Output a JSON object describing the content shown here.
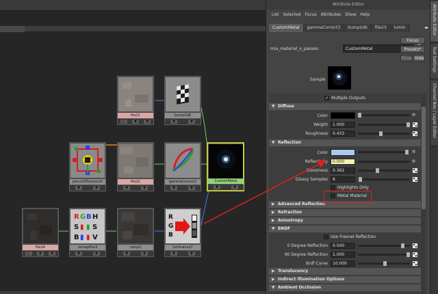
{
  "attribute_editor": {
    "title": "Attribute Editor",
    "menu": [
      "List",
      "Selected",
      "Focus",
      "Attributes",
      "Show",
      "Help"
    ],
    "tabs": [
      "CustomMetal",
      "gammaCorrect3",
      "bump2d6",
      "file23",
      "lumin"
    ],
    "active_tab": "CustomMetal",
    "node_type_label": "mia_material_x_passes:",
    "node_name": "CustomMetal",
    "buttons": {
      "focus": "Focus",
      "presets": "Presets*",
      "show": "Show",
      "hide": "Hide"
    },
    "sample_label": "Sample",
    "multiple_outputs": {
      "label": "Multiple Outputs",
      "checked": "✓"
    },
    "sections": {
      "diffuse": {
        "title": "Diffuse",
        "color_label": "Color",
        "color_value": "#000000",
        "weight_label": "Weight",
        "weight_value": "1.000",
        "weight_level": 1.0,
        "roughness_label": "Roughness",
        "roughness_value": "0.433",
        "roughness_level": 0.433
      },
      "reflection": {
        "title": "Reflection",
        "color_label": "Color",
        "color_value": "#a9c8f0",
        "reflectivity_label": "Reflectivity",
        "reflectivity_value": "0.000",
        "glossiness_label": "Glossiness",
        "glossiness_value": "0.362",
        "glossiness_level": 0.362,
        "glossy_samples_label": "Glossy Samples",
        "glossy_samples_value": "6",
        "highlights_only_label": "Highlights Only",
        "metal_material_label": "Metal Material"
      },
      "advanced_reflection": {
        "title": "Advanced Reflection"
      },
      "refraction": {
        "title": "Refraction"
      },
      "anisotropy": {
        "title": "Anisotropy"
      },
      "brdf": {
        "title": "BRDF",
        "use_fresnel_label": "Use Fresnel Reflection",
        "deg0_label": "0 Degree Reflection",
        "deg0_value": "0.500",
        "deg0_level": 0.5,
        "deg90_label": "90 Degree Reflection",
        "deg90_value": "1.000",
        "deg90_level": 1.0,
        "curve_label": "Brdf Curve",
        "curve_value": "10.000",
        "curve_level": 0.5
      },
      "translucency": {
        "title": "Translucency"
      },
      "indirect": {
        "title": "Indirect Illumination Options"
      },
      "ambient": {
        "title": "Ambient Occlusion"
      }
    }
  },
  "side_tabs": [
    "Attribute Editor",
    "Tool Settings",
    "Channel Box / Layer Editor"
  ],
  "nodes": {
    "file21": "file21",
    "bump2d6": "bump2d6",
    "place2dTexture10": "place2dTexture10",
    "file22": "file22",
    "gammaCorrect3": "gammaCorrect3",
    "CustomMetal": "CustomMetal",
    "file24": "file24",
    "remapHsv3": "remapHsv3",
    "ramp2": "ramp2",
    "luminance7": "luminance7"
  },
  "colors": {
    "annotation_red": "#e02020",
    "connection_green": "#74d06a",
    "connection_blue": "#4b7bff",
    "connection_orange": "#ffa11e"
  }
}
